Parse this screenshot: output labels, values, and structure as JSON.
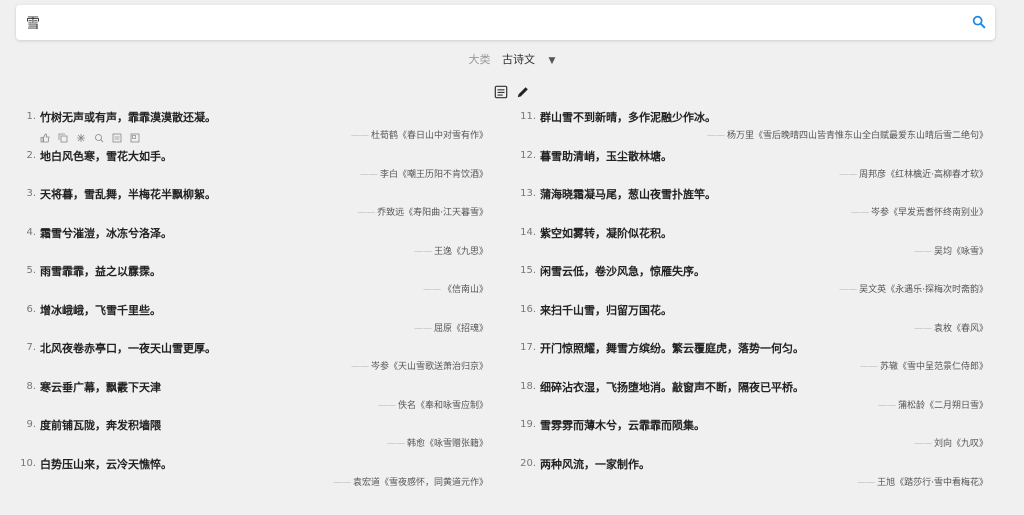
{
  "search": {
    "value": "雪",
    "placeholder": ""
  },
  "filter": {
    "label": "大类",
    "value": "古诗文"
  },
  "left_items": [
    {
      "num": "1.",
      "verse": "竹树无声或有声，霏霏漠漠散还凝。",
      "src": "杜荀鹤《春日山中对雪有作》"
    },
    {
      "num": "2.",
      "verse": "地白风色寒，雪花大如手。",
      "src": "李白《嘲王历阳不肯饮酒》"
    },
    {
      "num": "3.",
      "verse": "天将暮，雪乱舞，半梅花半飘柳絮。",
      "src": "乔致远《寿阳曲·江天暮雪》"
    },
    {
      "num": "4.",
      "verse": "霜雪兮漼溰，冰冻兮洛泽。",
      "src": "王逸《九思》"
    },
    {
      "num": "5.",
      "verse": "雨雪霏霏，益之以霡霂。",
      "src": "《信南山》"
    },
    {
      "num": "6.",
      "verse": "增冰峨峨，飞雪千里些。",
      "src": "屈原《招魂》"
    },
    {
      "num": "7.",
      "verse": "北风夜卷赤亭口，一夜天山雪更厚。",
      "src": "岑参《天山雪歌送萧治归京》"
    },
    {
      "num": "8.",
      "verse": "寒云垂广幕，飘霰下天津",
      "src": "佚名《奉和咏雪应制》"
    },
    {
      "num": "9.",
      "verse": "度前铺瓦陇，奔发积墙隈",
      "src": "韩愈《咏雪赠张籍》"
    },
    {
      "num": "10.",
      "verse": "白势压山来，云冷天憔悴。",
      "src": "袁宏道《雪夜感怀，同黄道元作》"
    }
  ],
  "right_items": [
    {
      "num": "11.",
      "verse": "群山雪不到新晴，多作泥融少作冰。",
      "src": "杨万里《雪后晚晴四山皆青惟东山全白赋最爱东山晴后雪二绝句》"
    },
    {
      "num": "12.",
      "verse": "暮雪助清峭，玉尘散林塘。",
      "src": "周邦彦《红林檎近·高柳春才软》"
    },
    {
      "num": "13.",
      "verse": "蒲海晓霜凝马尾，葱山夜雪扑旌竿。",
      "src": "岑参《早发焉耆怀终南别业》"
    },
    {
      "num": "14.",
      "verse": "紫空如雾转，凝阶似花积。",
      "src": "吴均《咏雪》"
    },
    {
      "num": "15.",
      "verse": "闲雪云低，卷沙风急，惊雁失序。",
      "src": "吴文英《永遇乐·探梅次时斋韵》"
    },
    {
      "num": "16.",
      "verse": "来扫千山雪，归留万国花。",
      "src": "袁枚《春风》"
    },
    {
      "num": "17.",
      "verse": "开门惊照耀，舞雪方缤纷。繁云覆庭虎，落势一何匀。",
      "src": "苏辙《雪中呈范景仁侍郎》"
    },
    {
      "num": "18.",
      "verse": "细碎沾衣湿，飞扬堕地消。敲窗声不断，隔夜已平桥。",
      "src": "蒲松龄《二月朔日雪》"
    },
    {
      "num": "19.",
      "verse": "雪雰雰而薄木兮，云霏霏而陨集。",
      "src": "刘向《九叹》"
    },
    {
      "num": "20.",
      "verse": "两种风流，一家制作。",
      "src": "王旭《踏莎行·雪中看梅花》"
    }
  ],
  "colors": {
    "accent": "#1e88e5",
    "background": "#f0f0f0"
  },
  "icons": {
    "search": "search-icon",
    "dropdown": "caret-down-icon",
    "view": "document-view-icon",
    "edit": "pencil-icon",
    "actions": [
      "thumb-up-icon",
      "copy-icon",
      "share-icon",
      "zoom-icon",
      "note-icon",
      "bookmark-icon"
    ]
  }
}
